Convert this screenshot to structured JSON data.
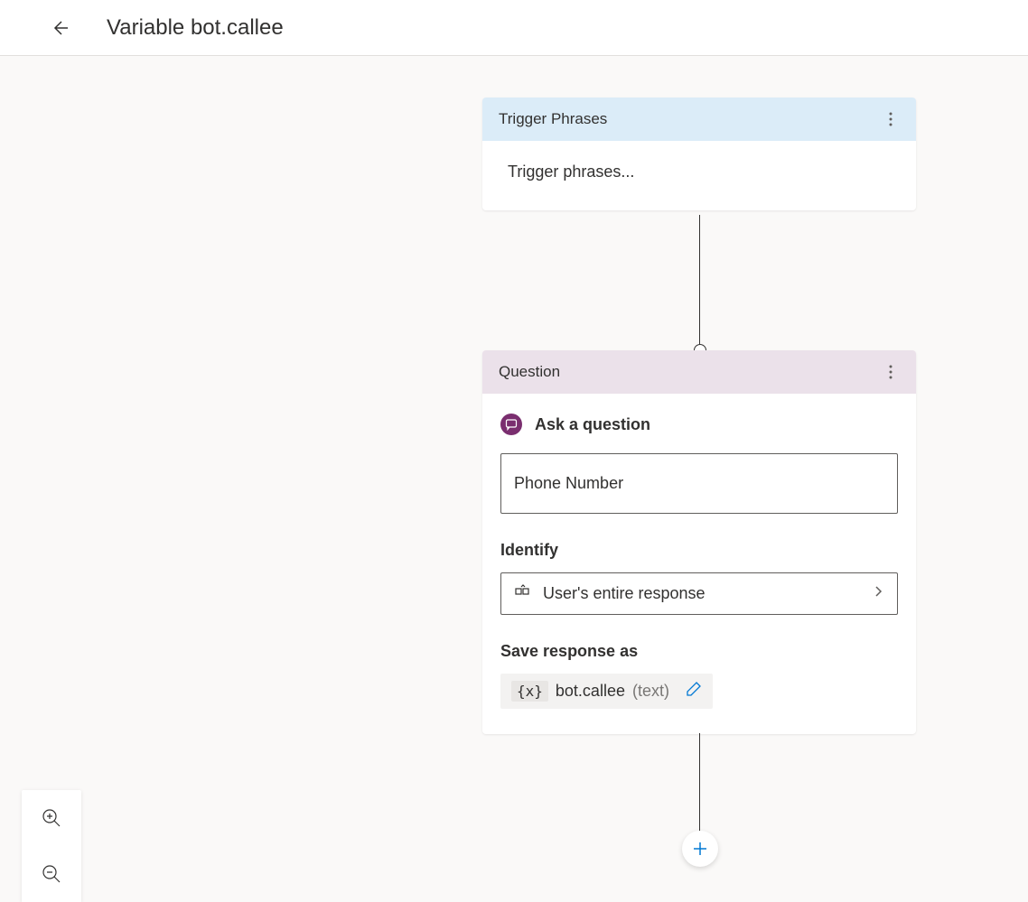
{
  "header": {
    "title": "Variable bot.callee"
  },
  "trigger_node": {
    "header": "Trigger Phrases",
    "body_text": "Trigger phrases..."
  },
  "question_node": {
    "header": "Question",
    "ask_label": "Ask a question",
    "input_value": "Phone Number",
    "identify_label": "Identify",
    "identify_value": "User's entire response",
    "save_label": "Save response as",
    "variable_badge": "{x}",
    "variable_name": "bot.callee",
    "variable_type": "(text)"
  }
}
